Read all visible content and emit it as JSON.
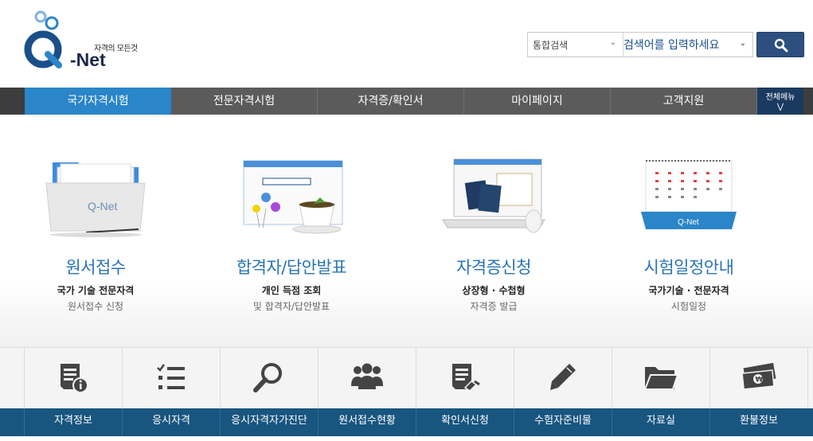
{
  "header": {
    "logo_tagline": "자격의 모든것",
    "logo_name": "-Net",
    "search": {
      "category": "통합검색",
      "placeholder": "검색어를 입력하세요",
      "button_icon": "search-icon"
    }
  },
  "nav": {
    "items": [
      {
        "label": "국가자격시험",
        "active": true
      },
      {
        "label": "전문자격시험"
      },
      {
        "label": "자격증/확인서"
      },
      {
        "label": "마이페이지"
      },
      {
        "label": "고객지원"
      }
    ],
    "all_menu": "전체메뉴"
  },
  "services": [
    {
      "title": "원서접수",
      "line1": "국가 기술 전문자격",
      "line2": "원서접수 신청",
      "illustration": "folder-illustration"
    },
    {
      "title": "합격자/답안발표",
      "line1": "개인 득점 조회",
      "line2": "및 합격자/답안발표",
      "illustration": "browser-teacup-illustration"
    },
    {
      "title": "자격증신청",
      "line1": "상장형 · 수첩형",
      "line2": "자격증 발급",
      "illustration": "laptop-passport-illustration"
    },
    {
      "title": "시험일정안내",
      "line1": "국가기술 · 전문자격",
      "line2": "시험일정",
      "illustration": "calendar-illustration"
    }
  ],
  "quick_links": [
    {
      "label": "자격정보",
      "icon": "document-info-icon"
    },
    {
      "label": "응시자격",
      "icon": "checklist-icon"
    },
    {
      "label": "응시자격자가진단",
      "icon": "magnifier-icon"
    },
    {
      "label": "원서접수현황",
      "icon": "people-group-icon"
    },
    {
      "label": "확인서신청",
      "icon": "document-edit-icon"
    },
    {
      "label": "수험자준비물",
      "icon": "pencil-icon"
    },
    {
      "label": "자료실",
      "icon": "folder-icon"
    },
    {
      "label": "환불정보",
      "icon": "money-icon"
    }
  ],
  "colors": {
    "accent": "#2a85c9",
    "nav_bg": "#5b5b5b",
    "title_blue": "#2a73b8",
    "quick_bar": "#18557f",
    "search_button": "#2d4f80"
  }
}
